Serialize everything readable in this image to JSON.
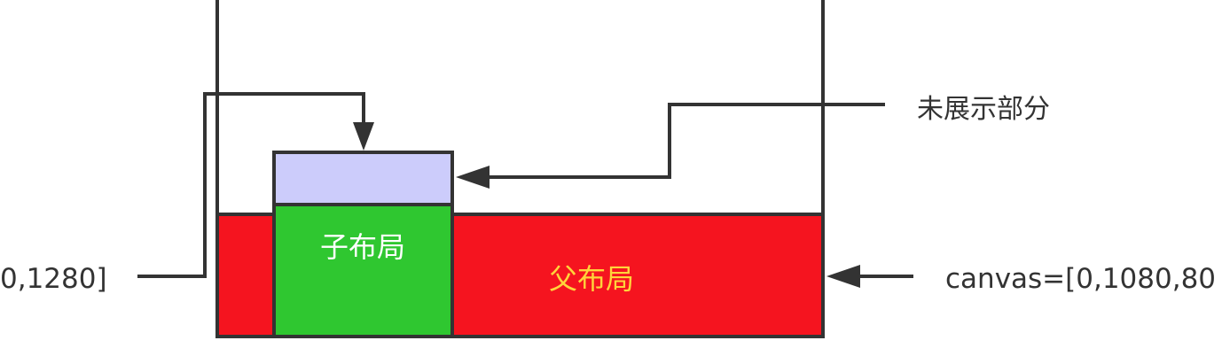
{
  "labels": {
    "unshown_part": "未展示部分",
    "child_layout": "子布局",
    "parent_layout": "父布局",
    "left_canvas": "0,1280]",
    "right_canvas": "canvas=[0,1080,80"
  },
  "colors": {
    "parent_fill": "#f5141f",
    "child_fill": "#2fc730",
    "unshown_fill": "#ccccfb",
    "stroke": "#333333",
    "child_text": "#ffffff",
    "parent_text": "#ffd43b",
    "annotation_text": "#333333"
  }
}
